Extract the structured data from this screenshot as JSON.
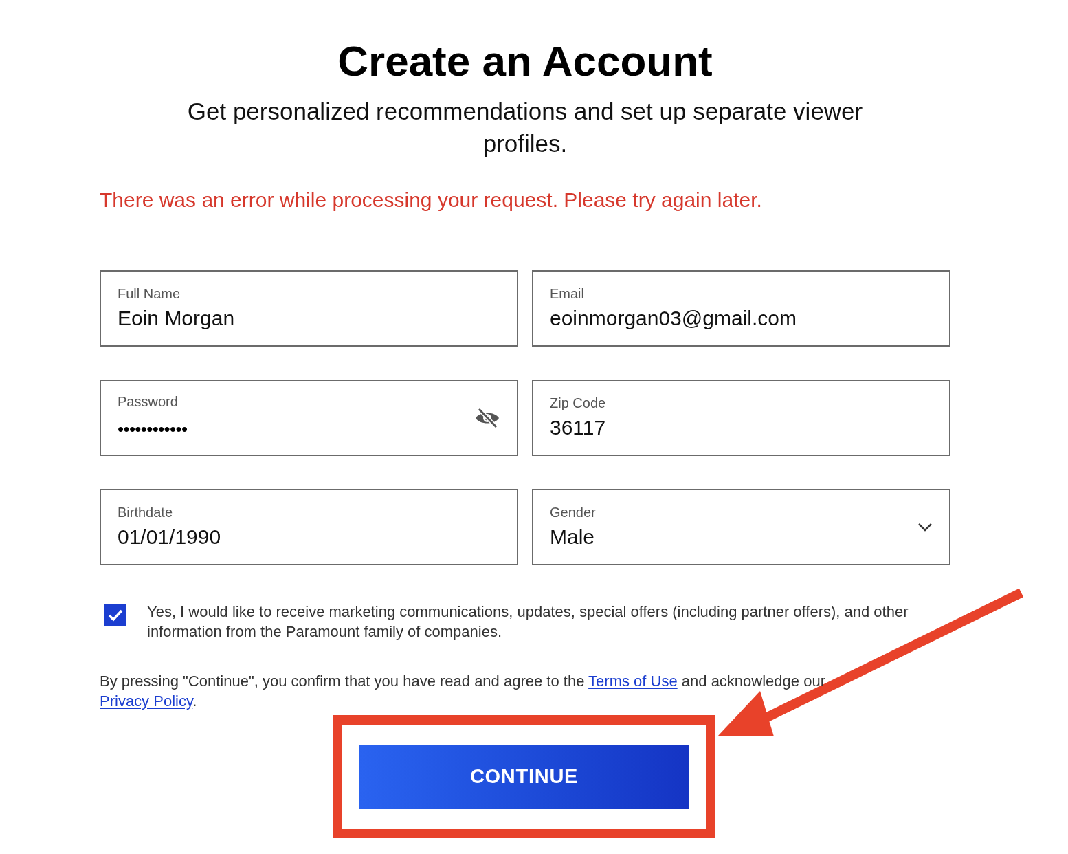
{
  "title": "Create an Account",
  "subtitle": "Get personalized recommendations and set up separate viewer profiles.",
  "error": "There was an error while processing your request. Please try again later.",
  "fields": [
    {
      "kind": "text",
      "label": "Full Name",
      "value": "Eoin Morgan"
    },
    {
      "kind": "text",
      "label": "Email",
      "value": "eoinmorgan03@gmail.com"
    },
    {
      "kind": "password",
      "label": "Password",
      "value": "••••••••••••"
    },
    {
      "kind": "text",
      "label": "Zip Code",
      "value": "36117"
    },
    {
      "kind": "text",
      "label": "Birthdate",
      "value": "01/01/1990"
    },
    {
      "kind": "select",
      "label": "Gender",
      "value": "Male"
    }
  ],
  "consent": {
    "checked": true,
    "text": "Yes, I would like to receive marketing communications, updates, special offers (including partner offers), and other information from the Paramount family of companies."
  },
  "legal": {
    "before": "By pressing \"Continue\", you confirm that you have read and agree to the",
    "terms_link": "Terms of Use",
    "middle": "and acknowledge our",
    "privacy_link": "Privacy Policy",
    "after": "."
  },
  "button": "CONTINUE"
}
